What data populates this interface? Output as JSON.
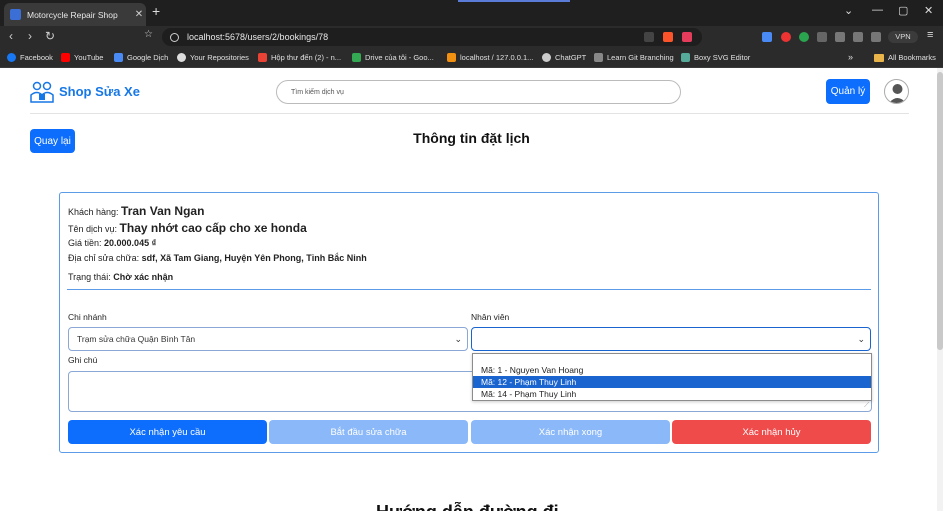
{
  "browser": {
    "tab_title": "Motorcycle Repair Shop",
    "url": "localhost:5678/users/2/bookings/78",
    "vpn_label": "VPN",
    "bookmarks": [
      "Facebook",
      "YouTube",
      "Google Dịch",
      "Your Repositories",
      "Hộp thư đến (2) - n...",
      "Drive của tôi - Goo...",
      "localhost / 127.0.0.1...",
      "ChatGPT",
      "Learn Git Branching",
      "Boxy SVG Editor"
    ],
    "all_bookmarks": "All Bookmarks"
  },
  "header": {
    "brand": "Shop Sửa Xe",
    "search_placeholder": "Tìm kiếm dịch vụ",
    "manager_button": "Quản lý"
  },
  "page": {
    "back_button": "Quay lại",
    "title": "Thông tin đặt lịch",
    "bottom_heading": "Hướng dẫn đường đi"
  },
  "booking": {
    "customer_label": "Khách hàng: ",
    "customer": "Tran Van Ngan",
    "service_label": "Tên dịch vụ: ",
    "service": "Thay nhớt cao cấp cho xe honda",
    "price_label": "Giá tiền: ",
    "price": "20.000.045 ₫",
    "address_label": "Địa chỉ sửa chữa: ",
    "address": "sdf, Xã Tam Giang, Huyện Yên Phong, Tỉnh Bắc Ninh",
    "status_label": "Trạng thái: ",
    "status": "Chờ xác nhận"
  },
  "form": {
    "branch_label": "Chi nhánh",
    "branch_value": "Trạm sửa chữa Quận Bình Tân",
    "staff_label": "Nhân viên",
    "staff_value": "",
    "staff_options": [
      "",
      "Mã: 1 - Nguyen Van Hoang",
      "Mã: 12 - Phạm Thuy Linh",
      "Mã: 14 - Phạm Thuy Linh"
    ],
    "staff_highlighted_index": 2,
    "note_label": "Ghi chú"
  },
  "actions": {
    "confirm_request": "Xác nhận yêu cầu",
    "start_repair": "Bắt đầu sửa chữa",
    "confirm_done": "Xác nhận xong",
    "confirm_cancel": "Xác nhận hủy"
  },
  "colors": {
    "primary": "#0d6efd",
    "primary_disabled": "#6ea8fe",
    "danger": "#f05252",
    "brand": "#1677e6"
  }
}
